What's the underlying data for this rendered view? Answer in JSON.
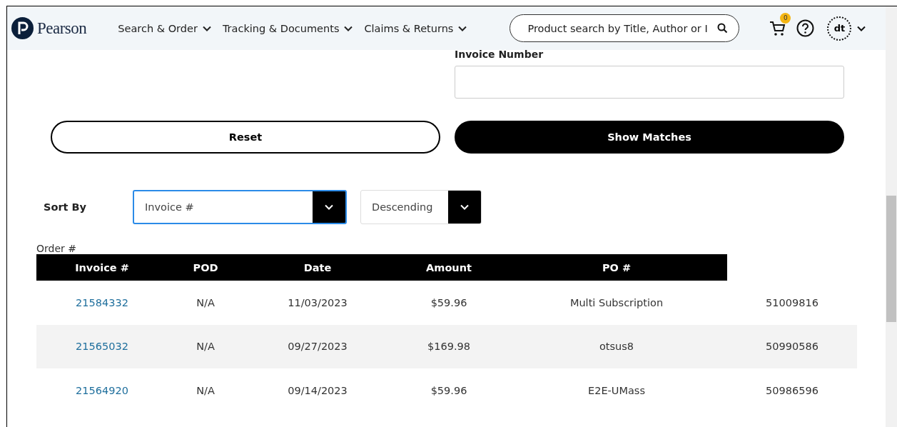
{
  "header": {
    "brand": "Pearson",
    "menus": [
      {
        "label": "Search & Order"
      },
      {
        "label": "Tracking & Documents"
      },
      {
        "label": "Claims & Returns"
      }
    ],
    "search": {
      "placeholder": "Product search by Title, Author or I"
    },
    "cart_count": "0",
    "avatar": "dt"
  },
  "form": {
    "invoice_number": {
      "label": "Invoice Number"
    },
    "reset": "Reset",
    "show_matches": "Show Matches"
  },
  "sort": {
    "label": "Sort By",
    "field": {
      "value": "Invoice #",
      "focused": true
    },
    "order": {
      "value": "Descending",
      "focused": false
    }
  },
  "table": {
    "caption": "Order #",
    "columns": [
      "Invoice #",
      "POD",
      "Date",
      "Amount",
      "PO #"
    ],
    "rows": [
      {
        "cells": [
          "21584332",
          "N/A",
          "11/03/2023",
          "$59.96",
          "Multi Subscription",
          "51009816"
        ],
        "striped": false
      },
      {
        "cells": [
          "21565032",
          "N/A",
          "09/27/2023",
          "$169.98",
          "otsus8",
          "50990586"
        ],
        "striped": true
      },
      {
        "cells": [
          "21564920",
          "N/A",
          "09/14/2023",
          "$59.96",
          "E2E-UMass",
          "50986596"
        ],
        "striped": false
      }
    ]
  }
}
